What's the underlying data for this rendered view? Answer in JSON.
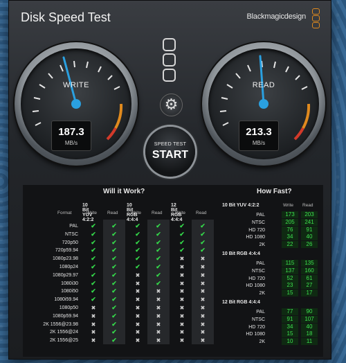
{
  "app": {
    "title": "Disk Speed Test",
    "brand": "Blackmagicdesign"
  },
  "write_gauge": {
    "label": "WRITE",
    "value": "187.3",
    "unit": "MB/s"
  },
  "read_gauge": {
    "label": "READ",
    "value": "213.3",
    "unit": "MB/s"
  },
  "start_button": {
    "small": "SPEED TEST",
    "big": "START"
  },
  "colors": {
    "ok": "#34d74a",
    "needle": "#2aa0e0",
    "redzone": "#d23a2a",
    "brand": "#e08a1e"
  },
  "will_it_work": {
    "heading": "Will it Work?",
    "format_label": "Format",
    "groups": [
      "10 Bit YUV 4:2:2",
      "10 Bit RGB 4:4:4",
      "12 Bit RGB 4:4:4"
    ],
    "sub": [
      "Write",
      "Read"
    ],
    "rows": [
      {
        "f": "PAL",
        "c": [
          1,
          1,
          1,
          1,
          1,
          1
        ]
      },
      {
        "f": "NTSC",
        "c": [
          1,
          1,
          1,
          1,
          1,
          1
        ]
      },
      {
        "f": "720p50",
        "c": [
          1,
          1,
          1,
          1,
          1,
          1
        ]
      },
      {
        "f": "720p59.94",
        "c": [
          1,
          1,
          1,
          1,
          1,
          1
        ]
      },
      {
        "f": "1080p23.98",
        "c": [
          1,
          1,
          1,
          1,
          0,
          0
        ]
      },
      {
        "f": "1080p24",
        "c": [
          1,
          1,
          1,
          1,
          0,
          0
        ]
      },
      {
        "f": "1080p29.97",
        "c": [
          1,
          1,
          0,
          1,
          0,
          0
        ]
      },
      {
        "f": "1080i30",
        "c": [
          1,
          1,
          0,
          1,
          0,
          0
        ]
      },
      {
        "f": "1080i50",
        "c": [
          1,
          1,
          0,
          0,
          0,
          0
        ]
      },
      {
        "f": "1080i59.94",
        "c": [
          1,
          1,
          0,
          0,
          0,
          0
        ]
      },
      {
        "f": "1080p50",
        "c": [
          0,
          1,
          0,
          0,
          0,
          0
        ]
      },
      {
        "f": "1080p59.94",
        "c": [
          0,
          1,
          0,
          0,
          0,
          0
        ]
      },
      {
        "f": "2K 1556@23.98",
        "c": [
          0,
          1,
          0,
          0,
          0,
          0
        ]
      },
      {
        "f": "2K 1556@24",
        "c": [
          0,
          1,
          0,
          0,
          0,
          0
        ]
      },
      {
        "f": "2K 1556@25",
        "c": [
          0,
          1,
          0,
          0,
          0,
          0
        ]
      }
    ]
  },
  "how_fast": {
    "heading": "How Fast?",
    "sub": [
      "Write",
      "Read"
    ],
    "groups": [
      {
        "name": "10 Bit YUV 4:2:2",
        "rows": [
          {
            "f": "PAL",
            "w": "173",
            "r": "203"
          },
          {
            "f": "NTSC",
            "w": "205",
            "r": "241"
          },
          {
            "f": "HD 720",
            "w": "76",
            "r": "91"
          },
          {
            "f": "HD 1080",
            "w": "34",
            "r": "40"
          },
          {
            "f": "2K",
            "w": "22",
            "r": "26"
          }
        ]
      },
      {
        "name": "10 Bit RGB 4:4:4",
        "rows": [
          {
            "f": "PAL",
            "w": "115",
            "r": "135"
          },
          {
            "f": "NTSC",
            "w": "137",
            "r": "160"
          },
          {
            "f": "HD 720",
            "w": "52",
            "r": "61"
          },
          {
            "f": "HD 1080",
            "w": "23",
            "r": "27"
          },
          {
            "f": "2K",
            "w": "15",
            "r": "17"
          }
        ]
      },
      {
        "name": "12 Bit RGB 4:4:4",
        "rows": [
          {
            "f": "PAL",
            "w": "77",
            "r": "90"
          },
          {
            "f": "NTSC",
            "w": "91",
            "r": "107"
          },
          {
            "f": "HD 720",
            "w": "34",
            "r": "40"
          },
          {
            "f": "HD 1080",
            "w": "15",
            "r": "18"
          },
          {
            "f": "2K",
            "w": "10",
            "r": "11"
          }
        ]
      }
    ]
  }
}
